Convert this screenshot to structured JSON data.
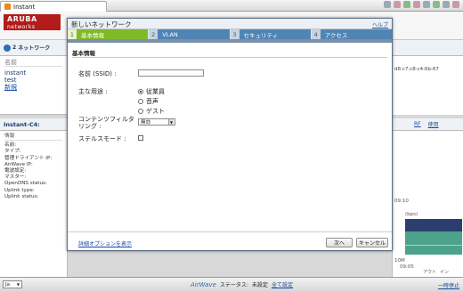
{
  "browser": {
    "tab_title": "Instant"
  },
  "logo": {
    "text_top": "ARUBA",
    "text_bottom": "networks"
  },
  "network_bar": {
    "count": "2",
    "label": "ネットワーク"
  },
  "left_panel": {
    "header": "名前",
    "items": [
      "instant",
      "test"
    ],
    "new_link": "新規"
  },
  "left_panel2": {
    "title": "Instant-C4:",
    "section": "情報",
    "lines": [
      "名前:",
      "タイプ:",
      "管理ドライアント IP:",
      "AirWave IP:",
      "電波設定:",
      "マスター:",
      "OpenDNS status:",
      "Uplink type:",
      "Uplink status:"
    ]
  },
  "right_panel": {
    "mac": "d8:c7:c8:c4:6b:67",
    "tabs": [
      "RF",
      "使用"
    ],
    "chart_labels": [
      "(bps)",
      "09:10",
      "09:05"
    ],
    "legend": [
      "アウト",
      "イン"
    ],
    "axis": [
      "10M",
      "0"
    ]
  },
  "dialog": {
    "title": "新しいネットワーク",
    "help": "ヘルプ",
    "steps": [
      {
        "num": "1",
        "label": "基本情報"
      },
      {
        "num": "2",
        "label": "VLAN"
      },
      {
        "num": "3",
        "label": "セキュリティ"
      },
      {
        "num": "4",
        "label": "アクセス"
      }
    ],
    "section_title": "基本情報",
    "name_label": "名前 (SSID) :",
    "name_value": "",
    "usage_label": "主な用途 :",
    "usage_options": [
      {
        "label": "従業員",
        "selected": true
      },
      {
        "label": "音声",
        "selected": false
      },
      {
        "label": "ゲスト",
        "selected": false
      }
    ],
    "filter_label_line1": "コンテンツフィルタ",
    "filter_label_line2": "リング :",
    "filter_value": "無効",
    "stealth_label": "ステルスモード :",
    "advanced_link": "詳細オプションを表示",
    "next_button": "次へ",
    "cancel_button": "キャンセル"
  },
  "footer": {
    "left_select": "Ja",
    "brand": "AirWave",
    "status_label": "ステータス:",
    "status_value": "未設定",
    "config_link": "全て設定",
    "right_link": "一時停止"
  },
  "colors": {
    "brand": "#b31b1b",
    "step_active": "#7fba26",
    "step_inactive": "#4f85b5",
    "link": "#1a4aa0"
  }
}
